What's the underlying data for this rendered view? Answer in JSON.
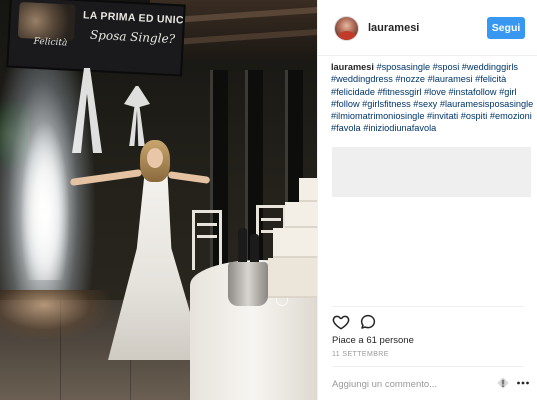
{
  "banner": {
    "line1": "LA PRIMA ED UNICA",
    "line2": "Sposa Single?",
    "line3": "Felicità"
  },
  "post": {
    "username": "lauramesi",
    "follow_label": "Segui",
    "caption_author": "lauramesi",
    "hashtags": [
      "#sposasingle",
      "#sposi",
      "#weddinggirls",
      "#weddingdress",
      "#nozze",
      "#lauramesi",
      "#felicità",
      "#felicidade",
      "#fitnessgirl",
      "#love",
      "#instafollow",
      "#girl",
      "#follow",
      "#girlsfitness",
      "#sexy",
      "#lauramesisposasingle",
      "#ilmiomatrimoniosingle",
      "#invitati",
      "#ospiti",
      "#emozioni",
      "#favola",
      "#iniziodiunafavola"
    ],
    "likes": "Piace a 61 persone",
    "date": "11 SETTEMBRE",
    "comment_placeholder": "Aggiungi un commento..."
  },
  "icons": {
    "like": "heart-icon",
    "comment": "comment-bubble-icon",
    "emoji": "emoji-icon",
    "more": "more-dots-icon"
  },
  "colors": {
    "follow_button": "#3897f0",
    "hashtag": "#003569",
    "muted": "#999999"
  }
}
